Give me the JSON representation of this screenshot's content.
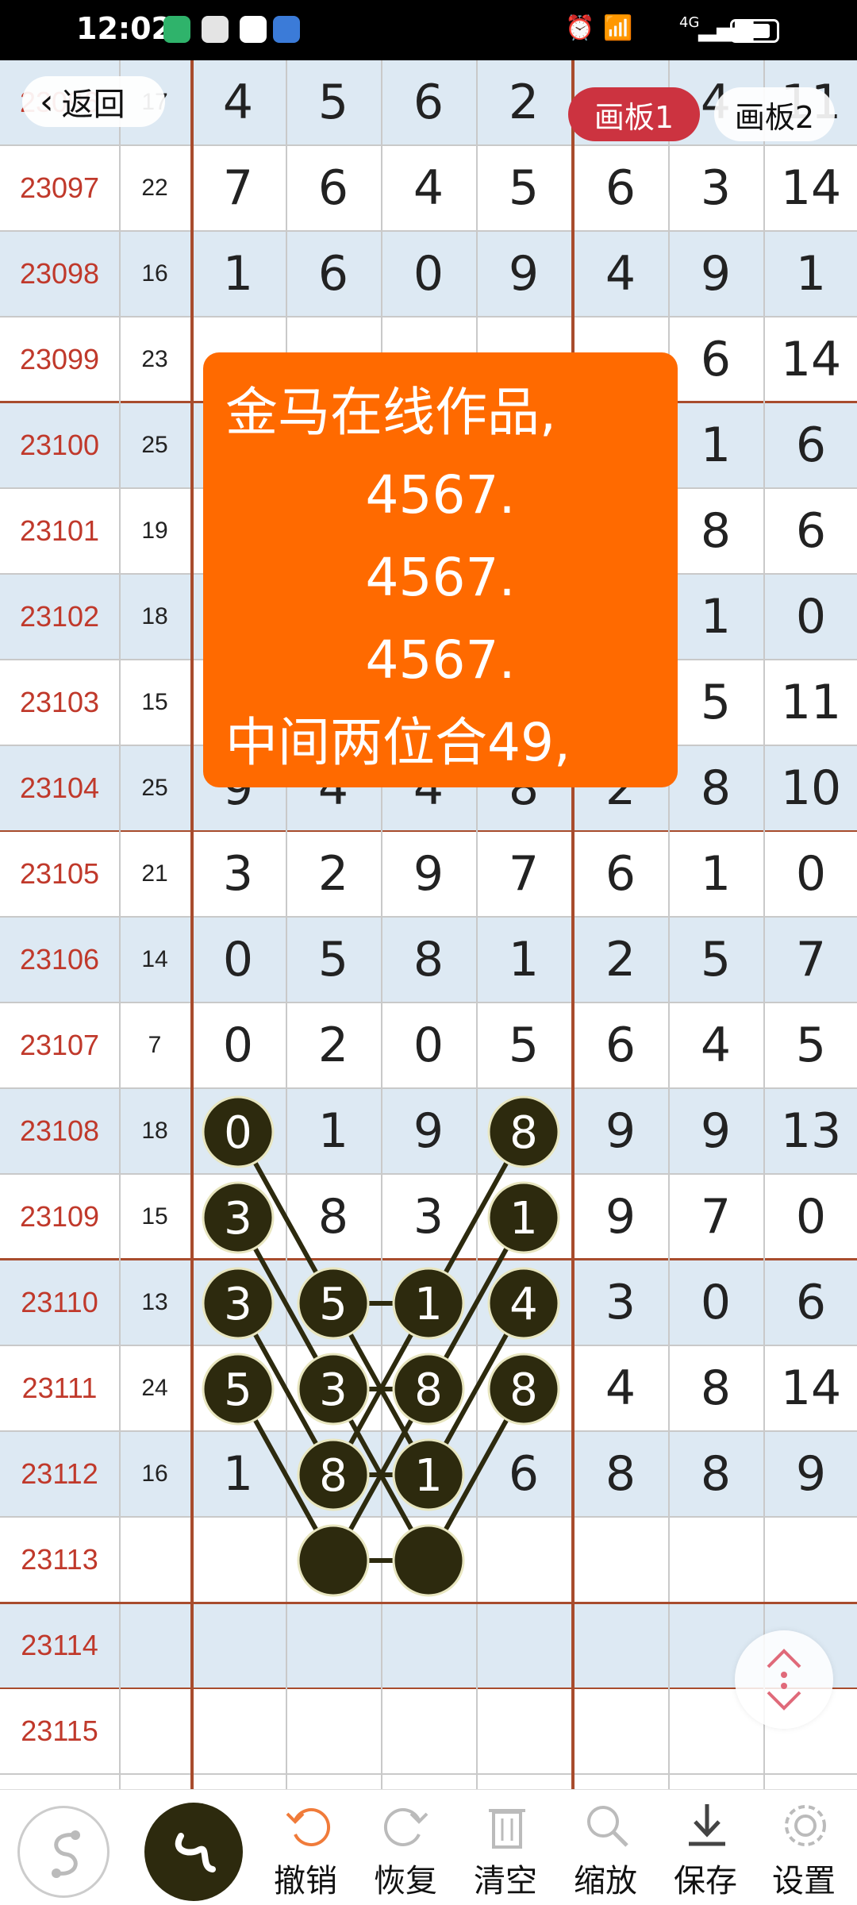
{
  "status_bar": {
    "time": "12:02",
    "network": "4G"
  },
  "nav": {
    "back_label": "返回",
    "tabs": [
      {
        "label": "画板1",
        "active": true
      },
      {
        "label": "画板2",
        "active": false
      }
    ]
  },
  "note": {
    "lines": [
      "金马在线作品,",
      "4567.",
      "4567.",
      "4567.",
      "中间两位合49,"
    ],
    "color": "#ff6a00"
  },
  "rows": [
    {
      "id": "23096",
      "sum": "17",
      "nums": [
        "4",
        "5",
        "6",
        "2",
        "",
        "4",
        "11"
      ]
    },
    {
      "id": "23097",
      "sum": "22",
      "nums": [
        "7",
        "6",
        "4",
        "5",
        "6",
        "3",
        "14"
      ]
    },
    {
      "id": "23098",
      "sum": "16",
      "nums": [
        "1",
        "6",
        "0",
        "9",
        "4",
        "9",
        "1"
      ]
    },
    {
      "id": "23099",
      "sum": "23",
      "nums": [
        "",
        "",
        "",
        "",
        "",
        "6",
        "14"
      ]
    },
    {
      "id": "23100",
      "sum": "25",
      "nums": [
        "",
        "",
        "",
        "",
        "",
        "1",
        "6"
      ]
    },
    {
      "id": "23101",
      "sum": "19",
      "nums": [
        "",
        "",
        "",
        "",
        "",
        "8",
        "6"
      ]
    },
    {
      "id": "23102",
      "sum": "18",
      "nums": [
        "",
        "",
        "",
        "",
        "",
        "1",
        "0"
      ]
    },
    {
      "id": "23103",
      "sum": "15",
      "nums": [
        "",
        "",
        "",
        "",
        "",
        "5",
        "11"
      ]
    },
    {
      "id": "23104",
      "sum": "25",
      "nums": [
        "9",
        "4",
        "4",
        "8",
        "2",
        "8",
        "10"
      ]
    },
    {
      "id": "23105",
      "sum": "21",
      "nums": [
        "3",
        "2",
        "9",
        "7",
        "6",
        "1",
        "0"
      ]
    },
    {
      "id": "23106",
      "sum": "14",
      "nums": [
        "0",
        "5",
        "8",
        "1",
        "2",
        "5",
        "7"
      ]
    },
    {
      "id": "23107",
      "sum": "7",
      "nums": [
        "0",
        "2",
        "0",
        "5",
        "6",
        "4",
        "5"
      ]
    },
    {
      "id": "23108",
      "sum": "18",
      "nums": [
        "0",
        "1",
        "9",
        "8",
        "9",
        "9",
        "13"
      ]
    },
    {
      "id": "23109",
      "sum": "15",
      "nums": [
        "3",
        "8",
        "3",
        "1",
        "9",
        "7",
        "0"
      ]
    },
    {
      "id": "23110",
      "sum": "13",
      "nums": [
        "3",
        "5",
        "1",
        "4",
        "3",
        "0",
        "6"
      ]
    },
    {
      "id": "23111",
      "sum": "24",
      "nums": [
        "5",
        "3",
        "8",
        "8",
        "4",
        "8",
        "14"
      ]
    },
    {
      "id": "23112",
      "sum": "16",
      "nums": [
        "1",
        "8",
        "1",
        "6",
        "8",
        "8",
        "9"
      ]
    },
    {
      "id": "23113",
      "sum": "",
      "nums": [
        "",
        "",
        "",
        "",
        "",
        "",
        ""
      ]
    },
    {
      "id": "23114",
      "sum": "",
      "nums": [
        "",
        "",
        "",
        "",
        "",
        "",
        ""
      ]
    },
    {
      "id": "23115",
      "sum": "",
      "nums": [
        "",
        "",
        "",
        "",
        "",
        "",
        ""
      ]
    }
  ],
  "balls": [
    {
      "row": 12,
      "col": 0,
      "text": "0"
    },
    {
      "row": 12,
      "col": 3,
      "text": "8"
    },
    {
      "row": 13,
      "col": 0,
      "text": "3"
    },
    {
      "row": 13,
      "col": 3,
      "text": "1"
    },
    {
      "row": 14,
      "col": 0,
      "text": "3"
    },
    {
      "row": 14,
      "col": 1,
      "text": "5"
    },
    {
      "row": 14,
      "col": 2,
      "text": "1"
    },
    {
      "row": 14,
      "col": 3,
      "text": "4"
    },
    {
      "row": 15,
      "col": 0,
      "text": "5"
    },
    {
      "row": 15,
      "col": 1,
      "text": "3"
    },
    {
      "row": 15,
      "col": 2,
      "text": "8"
    },
    {
      "row": 15,
      "col": 3,
      "text": "8"
    },
    {
      "row": 16,
      "col": 1,
      "text": "8"
    },
    {
      "row": 16,
      "col": 2,
      "text": "1"
    },
    {
      "row": 17,
      "col": 1,
      "text": ""
    },
    {
      "row": 17,
      "col": 2,
      "text": ""
    }
  ],
  "lines": [
    [
      12,
      0,
      14,
      1
    ],
    [
      14,
      1,
      16,
      2
    ],
    [
      13,
      0,
      15,
      1
    ],
    [
      15,
      1,
      17,
      2
    ],
    [
      14,
      0,
      16,
      1
    ],
    [
      15,
      0,
      17,
      1
    ],
    [
      12,
      3,
      14,
      2
    ],
    [
      14,
      2,
      16,
      1
    ],
    [
      13,
      3,
      15,
      2
    ],
    [
      15,
      2,
      17,
      1
    ],
    [
      14,
      3,
      16,
      2
    ],
    [
      15,
      3,
      17,
      2
    ],
    [
      14,
      1,
      14,
      2
    ],
    [
      15,
      1,
      15,
      2
    ],
    [
      16,
      1,
      16,
      2
    ],
    [
      17,
      1,
      17,
      2
    ]
  ],
  "ball_color": "#2d2a0e",
  "toolbar": {
    "items": [
      {
        "label": "撤销",
        "icon": "undo-icon"
      },
      {
        "label": "恢复",
        "icon": "redo-icon"
      },
      {
        "label": "清空",
        "icon": "trash-icon"
      },
      {
        "label": "缩放",
        "icon": "zoom-icon"
      },
      {
        "label": "保存",
        "icon": "download-icon"
      },
      {
        "label": "设置",
        "icon": "gear-icon"
      }
    ]
  }
}
